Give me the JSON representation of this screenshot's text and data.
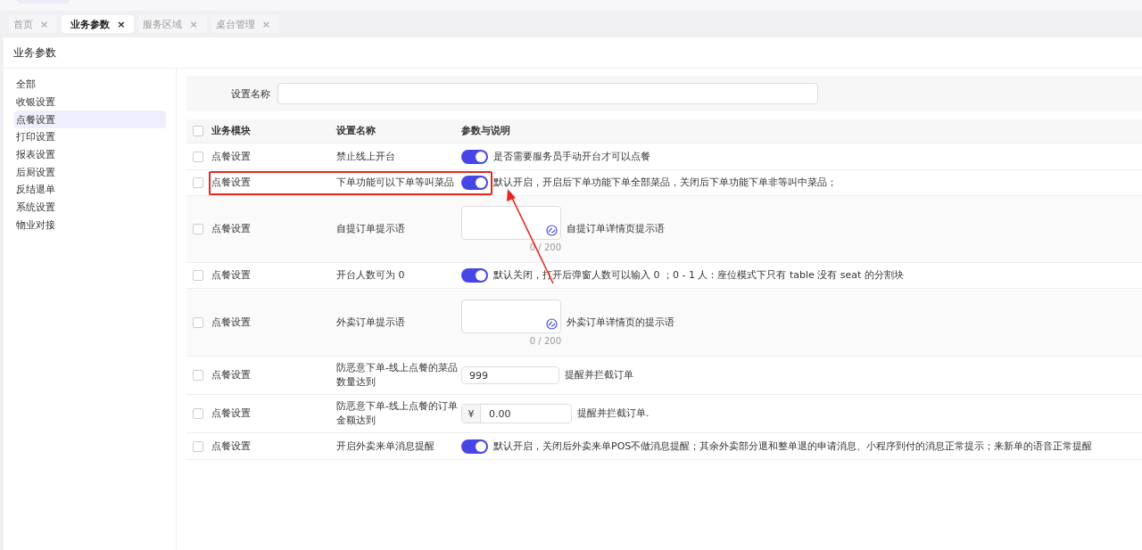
{
  "tabs": [
    {
      "label": "首页",
      "close": "×",
      "selected": false
    },
    {
      "label": "业务参数",
      "close": "×",
      "selected": true
    },
    {
      "label": "服务区域",
      "close": "×",
      "selected": false
    },
    {
      "label": "桌台管理",
      "close": "×",
      "selected": false
    }
  ],
  "page_title": "业务参数",
  "sidebar": {
    "items": [
      {
        "label": "全部",
        "selected": false
      },
      {
        "label": "收银设置",
        "selected": false
      },
      {
        "label": "点餐设置",
        "selected": true
      },
      {
        "label": "打印设置",
        "selected": false
      },
      {
        "label": "报表设置",
        "selected": false
      },
      {
        "label": "后厨设置",
        "selected": false
      },
      {
        "label": "反结退单",
        "selected": false
      },
      {
        "label": "系统设置",
        "selected": false
      },
      {
        "label": "物业对接",
        "selected": false
      }
    ]
  },
  "filter": {
    "label": "设置名称"
  },
  "table": {
    "all_checked": false,
    "columns": [
      "业务模块",
      "设置名称",
      "参数与说明"
    ],
    "rows": [
      {
        "kind": "switch",
        "checked": false,
        "module": "点餐设置",
        "name": "禁止线上开台",
        "on": true,
        "description": "是否需要服务员手动开台才可以点餐",
        "highlighted": false
      },
      {
        "kind": "switch",
        "checked": false,
        "module": "点餐设置",
        "name": "下单功能可以下单等叫菜品",
        "on": true,
        "description": "默认开启，开启后下单功能下单全部菜品，关闭后下单功能下单非等叫中菜品；",
        "highlighted": true
      },
      {
        "kind": "textarea",
        "checked": false,
        "module": "点餐设置",
        "name": "自提订单提示语",
        "counter": "0 / 200",
        "description": "自提订单详情页提示语",
        "highlighted": false
      },
      {
        "kind": "switch",
        "checked": false,
        "module": "点餐设置",
        "name": "开台人数可为 0",
        "on": true,
        "description": "默认关闭，打开后弹窗人数可以输入 0 ；0 - 1 人：座位模式下只有 table 没有 seat 的分割块",
        "highlighted": false
      },
      {
        "kind": "textarea",
        "checked": false,
        "module": "点餐设置",
        "name": "外卖订单提示语",
        "counter": "0 / 200",
        "description": "外卖订单详情页的提示语",
        "highlighted": false
      },
      {
        "kind": "number",
        "checked": false,
        "module": "点餐设置",
        "name": "防恶意下单-线上点餐的菜品数量达到",
        "value": "999",
        "description": "提醒并拦截订单",
        "highlighted": false
      },
      {
        "kind": "money",
        "checked": false,
        "module": "点餐设置",
        "name": "防恶意下单-线上点餐的订单金额达到",
        "prefix": "¥",
        "value": "0.00",
        "description": "提醒并拦截订单.",
        "highlighted": false
      },
      {
        "kind": "switch",
        "checked": false,
        "module": "点餐设置",
        "name": "开启外卖来单消息提醒",
        "on": true,
        "description": "默认开启，关闭后外卖来单POS不做消息提醒；其余外卖部分退和整单退的申请消息、小程序到付的消息正常提示；来新单的语音正常提醒",
        "highlighted": false
      }
    ]
  }
}
